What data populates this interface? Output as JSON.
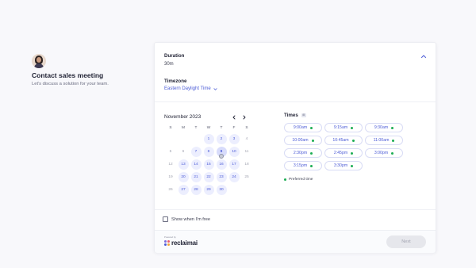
{
  "intro": {
    "title": "Contact sales meeting",
    "subtitle": "Let's discuss a solution for your team."
  },
  "duration": {
    "label": "Duration",
    "value": "30m"
  },
  "timezone": {
    "label": "Timezone",
    "value": "Eastern Daylight Time"
  },
  "calendar": {
    "month": "November 2023",
    "weekdays": [
      "S",
      "M",
      "T",
      "W",
      "T",
      "F",
      "S"
    ],
    "selected_day": "9",
    "weeks": [
      [
        {
          "d": "",
          "s": "empty"
        },
        {
          "d": "",
          "s": "empty"
        },
        {
          "d": "",
          "s": "empty"
        },
        {
          "d": "1",
          "s": "avail"
        },
        {
          "d": "2",
          "s": "avail"
        },
        {
          "d": "3",
          "s": "avail"
        },
        {
          "d": "4",
          "s": "off"
        }
      ],
      [
        {
          "d": "5",
          "s": "off"
        },
        {
          "d": "6",
          "s": "off"
        },
        {
          "d": "7",
          "s": "avail"
        },
        {
          "d": "8",
          "s": "avail"
        },
        {
          "d": "9",
          "s": "sel"
        },
        {
          "d": "10",
          "s": "avail"
        },
        {
          "d": "11",
          "s": "off"
        }
      ],
      [
        {
          "d": "12",
          "s": "off"
        },
        {
          "d": "13",
          "s": "avail"
        },
        {
          "d": "14",
          "s": "avail"
        },
        {
          "d": "15",
          "s": "avail"
        },
        {
          "d": "16",
          "s": "avail"
        },
        {
          "d": "17",
          "s": "avail"
        },
        {
          "d": "18",
          "s": "off"
        }
      ],
      [
        {
          "d": "19",
          "s": "off"
        },
        {
          "d": "20",
          "s": "avail"
        },
        {
          "d": "21",
          "s": "avail"
        },
        {
          "d": "22",
          "s": "avail"
        },
        {
          "d": "23",
          "s": "avail"
        },
        {
          "d": "24",
          "s": "avail"
        },
        {
          "d": "25",
          "s": "off"
        }
      ],
      [
        {
          "d": "26",
          "s": "off"
        },
        {
          "d": "27",
          "s": "avail"
        },
        {
          "d": "28",
          "s": "avail"
        },
        {
          "d": "29",
          "s": "avail"
        },
        {
          "d": "30",
          "s": "avail"
        },
        {
          "d": "",
          "s": "empty"
        },
        {
          "d": "",
          "s": "empty"
        }
      ]
    ]
  },
  "times": {
    "label": "Times",
    "slots": [
      "9:00am",
      "9:15am",
      "9:30am",
      "10:00am",
      "10:45am",
      "11:00am",
      "2:30pm",
      "2:45pm",
      "3:00pm",
      "3:15pm",
      "3:30pm"
    ],
    "legend": "Preferred time",
    "preferred_color": "#1eae54"
  },
  "free_toggle": {
    "label": "Show when I'm free",
    "checked": false
  },
  "footer": {
    "powered_by": "Powered by",
    "brand": "reclaimai",
    "next_label": "Next"
  },
  "colors": {
    "accent": "#4b5bd6",
    "available_bg": "#eceefe",
    "selected_bg": "#d8dcfb"
  }
}
